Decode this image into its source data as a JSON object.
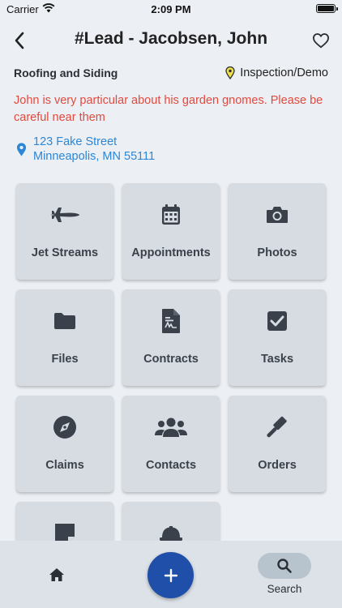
{
  "status_bar": {
    "carrier": "Carrier",
    "time": "2:09 PM"
  },
  "header": {
    "title": "#Lead - Jacobsen, John"
  },
  "lead": {
    "trade": "Roofing and Siding",
    "stage": "Inspection/Demo",
    "note": "John is very particular about his garden gnomes. Please be careful near them",
    "address_line1": "123 Fake Street",
    "address_line2": "Minneapolis, MN 55111"
  },
  "tiles": [
    {
      "label": "Jet Streams",
      "icon": "jet-icon"
    },
    {
      "label": "Appointments",
      "icon": "calendar-icon"
    },
    {
      "label": "Photos",
      "icon": "camera-icon"
    },
    {
      "label": "Files",
      "icon": "folder-icon"
    },
    {
      "label": "Contracts",
      "icon": "contract-icon"
    },
    {
      "label": "Tasks",
      "icon": "checkbox-icon"
    },
    {
      "label": "Claims",
      "icon": "compass-icon"
    },
    {
      "label": "Contacts",
      "icon": "users-icon"
    },
    {
      "label": "Orders",
      "icon": "gavel-icon"
    },
    {
      "label": "",
      "icon": "note-icon"
    },
    {
      "label": "",
      "icon": "hard-hat-icon"
    }
  ],
  "bottom_nav": {
    "search_label": "Search"
  },
  "colors": {
    "accent": "#1f4fa8",
    "link": "#2d86d6",
    "warning": "#e04a3f",
    "tile": "#d6dce2"
  }
}
